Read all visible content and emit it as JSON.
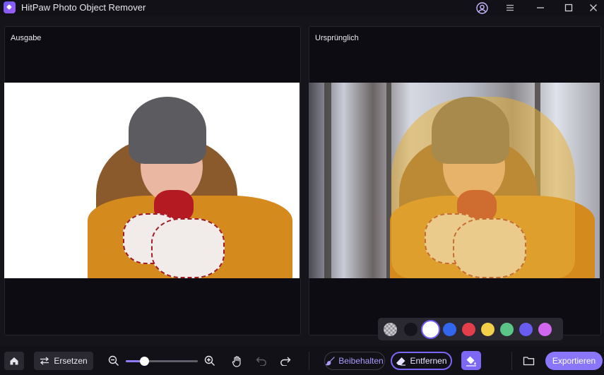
{
  "app": {
    "title": "HitPaw Photo Object Remover"
  },
  "panels": {
    "output_label": "Ausgabe",
    "original_label": "Ursprünglich"
  },
  "palette": {
    "colors": [
      "transparent",
      "#15141c",
      "#ffffff",
      "#3366ee",
      "#e43d4c",
      "#f3d04a",
      "#5bc487",
      "#6a5cf0",
      "#d067ee"
    ],
    "selected": 2
  },
  "toolbar": {
    "replace_label": "Ersetzen",
    "zoom_level": 0.25,
    "keep_label": "Beibehalten",
    "remove_label": "Entfernen",
    "export_label": "Exportieren"
  },
  "icons": {
    "home": "home-icon",
    "replace": "swap-icon",
    "zoom_out": "zoom-out-icon",
    "zoom_in": "zoom-in-icon",
    "hand": "hand-icon",
    "undo": "undo-icon",
    "redo": "redo-icon",
    "brush": "brush-icon",
    "eraser": "eraser-icon",
    "fill": "paint-bucket-icon",
    "folder": "folder-icon",
    "avatar": "user-icon",
    "menu": "menu-icon"
  },
  "colors": {
    "accent": "#8a76f8",
    "background": "#15141b",
    "panel": "#0d0c12"
  }
}
